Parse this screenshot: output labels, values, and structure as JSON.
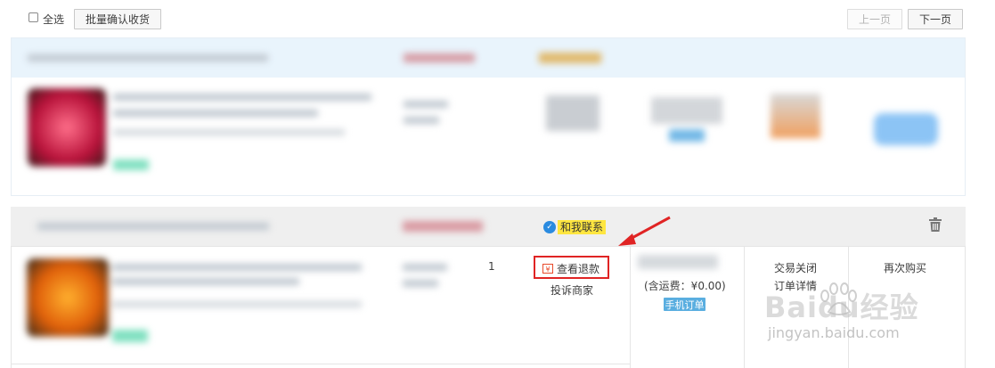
{
  "toolbar": {
    "select_all_label": "全选",
    "batch_confirm_label": "批量确认收货",
    "prev_page_label": "上一页",
    "next_page_label": "下一页"
  },
  "order2": {
    "contact_label": "和我联系",
    "quantity": "1",
    "refund_icon_glyph": "¥",
    "view_refund_label": "查看退款",
    "complain_label": "投诉商家",
    "shipping_label": "(含运费：¥0.00)",
    "mobile_order_tag": "手机订单",
    "status_label": "交易关闭",
    "order_detail_label": "订单详情",
    "buy_again_label": "再次购买"
  },
  "watermark": {
    "brand": "Baidu经验",
    "url": "jingyan.baidu.com"
  },
  "colors": {
    "accent_red": "#e02424",
    "tag_blue": "#5aaee0",
    "contact_yellow": "#ffe640",
    "header_blue": "#e9f4fc"
  },
  "icons": [
    "checkbox-icon",
    "contact-icon",
    "refund-icon",
    "trash-icon",
    "arrow-annotation-icon"
  ]
}
